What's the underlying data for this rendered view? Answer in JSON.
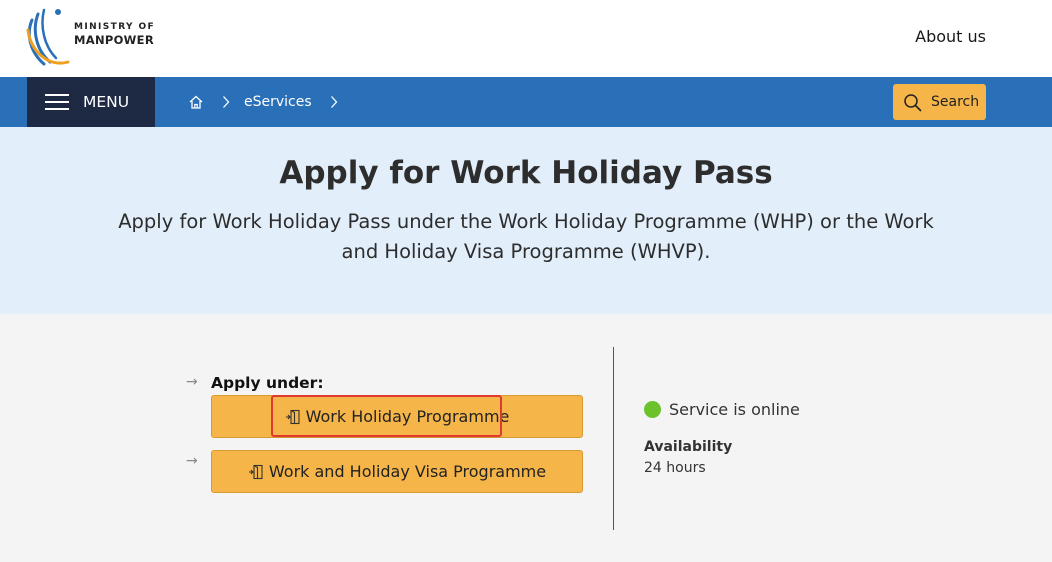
{
  "header": {
    "logo": {
      "line1": "MINISTRY OF",
      "line2": "MANPOWER"
    },
    "about_link": "About us"
  },
  "nav": {
    "menu_label": "MENU",
    "breadcrumb": [
      {
        "icon": "home-icon"
      },
      {
        "label": "eServices"
      }
    ],
    "search_label": "Search"
  },
  "hero": {
    "title": "Apply for Work Holiday Pass",
    "subtitle": "Apply for Work Holiday Pass under the Work Holiday Programme (WHP) or the Work and Holiday Visa Programme (WHVP)."
  },
  "apply": {
    "label": "Apply under:",
    "options": [
      {
        "label": "Work Holiday Programme",
        "icon": "document-exit-icon",
        "highlighted": true
      },
      {
        "label": "Work and Holiday Visa Programme",
        "icon": "document-exit-icon",
        "highlighted": false
      }
    ]
  },
  "service": {
    "status_text": "Service is online",
    "availability_label": "Availability",
    "availability_value": "24 hours"
  },
  "colors": {
    "nav_blue": "#2a70b8",
    "menu_navy": "#1e2a44",
    "accent_yellow": "#f5b549",
    "hero_bg": "#e2effa",
    "online_green": "#6cc22b",
    "highlight_red": "#e03a2f"
  }
}
